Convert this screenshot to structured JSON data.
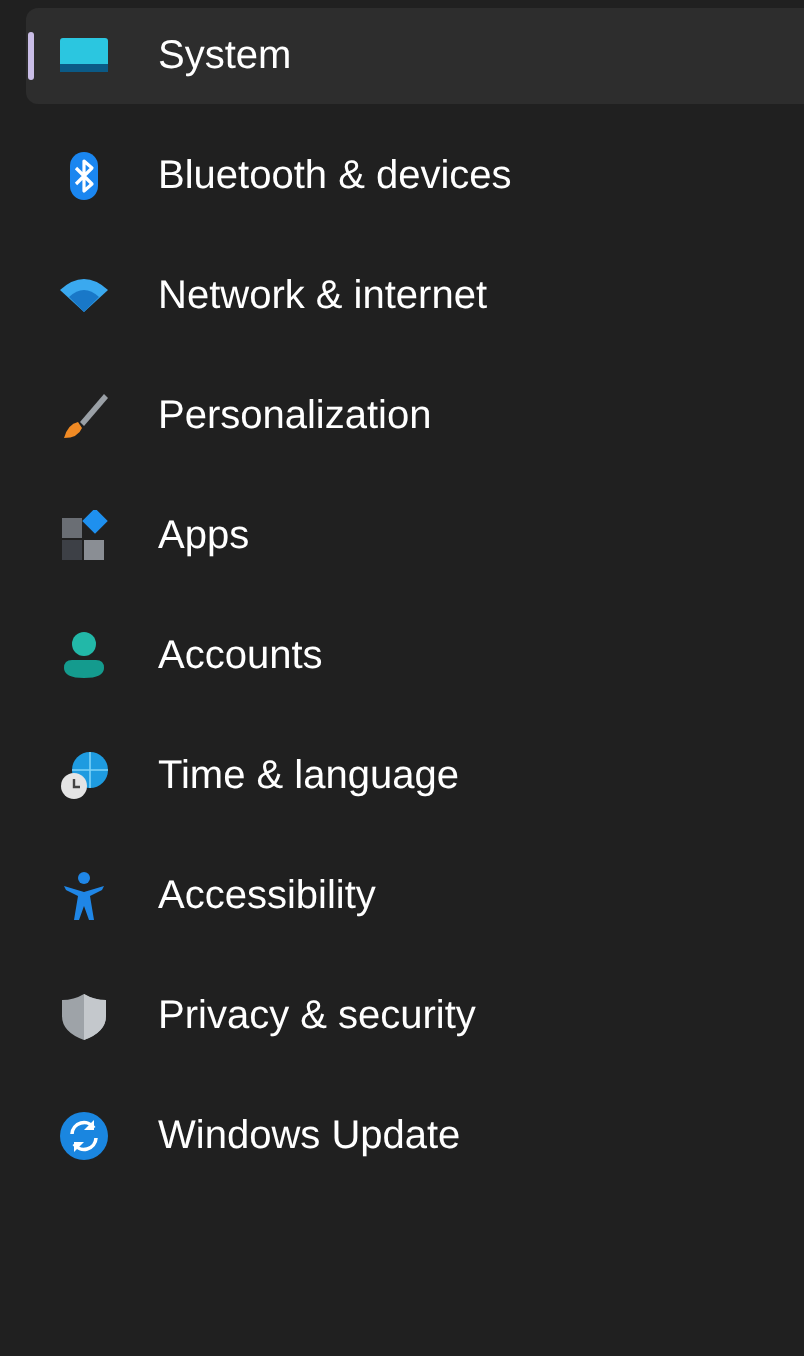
{
  "sidebar": {
    "items": [
      {
        "label": "System",
        "selected": true
      },
      {
        "label": "Bluetooth & devices",
        "selected": false
      },
      {
        "label": "Network & internet",
        "selected": false
      },
      {
        "label": "Personalization",
        "selected": false
      },
      {
        "label": "Apps",
        "selected": false
      },
      {
        "label": "Accounts",
        "selected": false
      },
      {
        "label": "Time & language",
        "selected": false
      },
      {
        "label": "Accessibility",
        "selected": false
      },
      {
        "label": "Privacy & security",
        "selected": false
      },
      {
        "label": "Windows Update",
        "selected": false
      }
    ]
  }
}
